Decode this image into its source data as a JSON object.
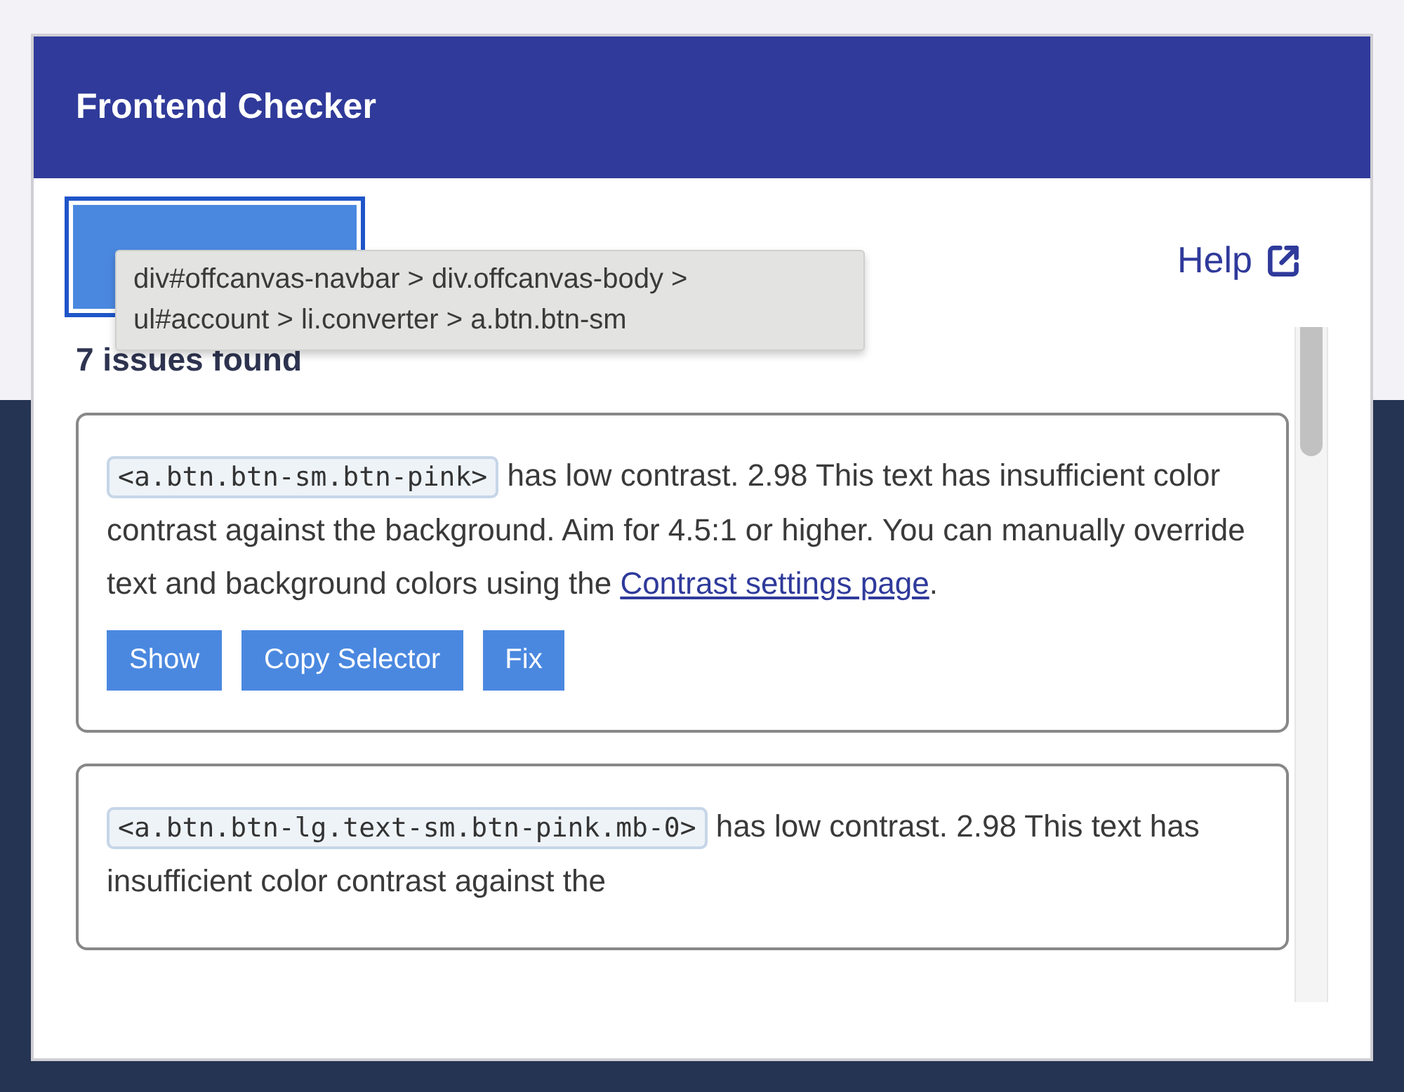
{
  "header": {
    "title": "Frontend Checker"
  },
  "tooltip": {
    "lines": [
      "div#offcanvas-navbar > div.offcanvas-body >",
      "ul#account > li.converter > a.btn.btn-sm"
    ]
  },
  "help_link": {
    "label": "Help"
  },
  "summary": "7 issues found",
  "issues": [
    {
      "selector": "<a.btn.btn-sm.btn-pink>",
      "text": "has low contrast. 2.98 This text has insufficient color contrast against the background. Aim for 4.5:1 or higher. You can manually override text and background colors using the ",
      "link": "Contrast settings page",
      "after": ".",
      "actions": [
        "Show",
        "Copy Selector",
        "Fix"
      ]
    },
    {
      "selector": "<a.btn.btn-lg.text-sm.btn-pink.mb-0>",
      "text": "has low contrast. 2.98 This text has insufficient color contrast against the"
    }
  ]
}
